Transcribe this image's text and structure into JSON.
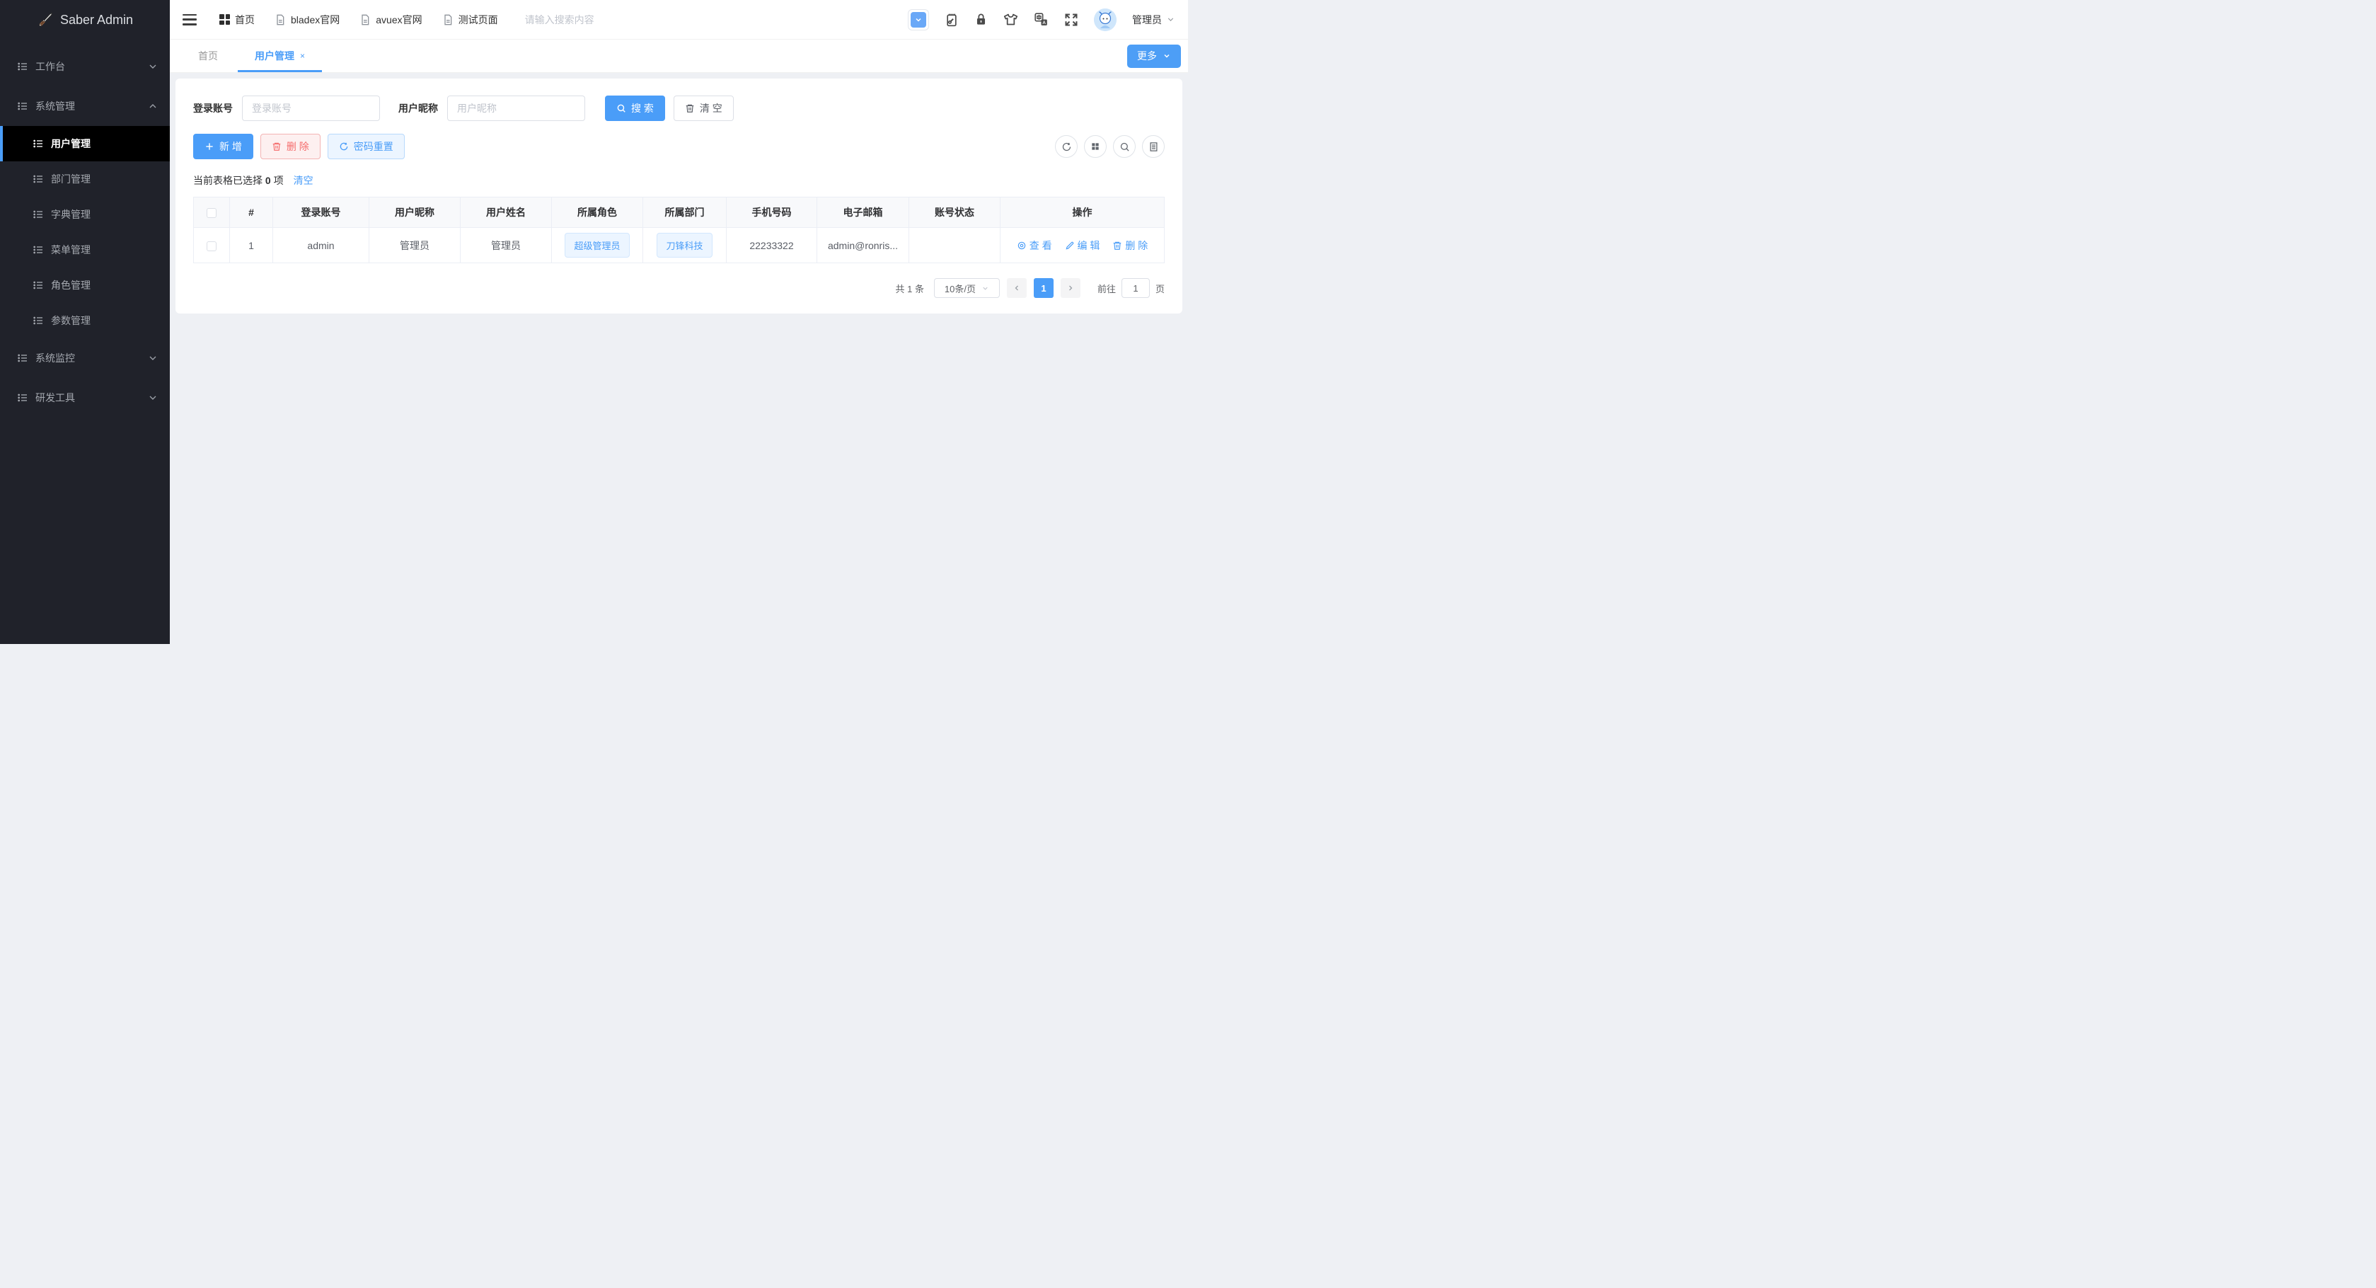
{
  "colors": {
    "accent": "#4a9df8",
    "link_blue": "#409eff",
    "danger_red": "#f56c6c",
    "sidebar_bg": "#20222a",
    "sidebar_active_bg": "#000000",
    "content_bg": "#eef0f4",
    "tag_bg": "#ecf5ff"
  },
  "logo": {
    "title": "Saber Admin"
  },
  "sidebar": {
    "items": [
      {
        "label": "工作台",
        "state": "collapsed"
      },
      {
        "label": "系统管理",
        "state": "expanded"
      },
      {
        "label": "系统监控",
        "state": "collapsed"
      },
      {
        "label": "研发工具",
        "state": "collapsed"
      }
    ],
    "system_children": [
      {
        "label": "用户管理",
        "active": true
      },
      {
        "label": "部门管理",
        "active": false
      },
      {
        "label": "字典管理",
        "active": false
      },
      {
        "label": "菜单管理",
        "active": false
      },
      {
        "label": "角色管理",
        "active": false
      },
      {
        "label": "参数管理",
        "active": false
      }
    ]
  },
  "topbar": {
    "nav": [
      {
        "label": "首页",
        "icon": "grid-icon"
      },
      {
        "label": "bladex官网",
        "icon": "document-icon"
      },
      {
        "label": "avuex官网",
        "icon": "document-icon"
      },
      {
        "label": "测试页面",
        "icon": "document-icon"
      }
    ],
    "search_placeholder": "请输入搜索内容",
    "user_name": "管理员"
  },
  "tabs": {
    "items": [
      {
        "label": "首页",
        "active": false
      },
      {
        "label": "用户管理",
        "active": true,
        "close": "×"
      }
    ],
    "more_label": "更多"
  },
  "filters": {
    "account_label": "登录账号",
    "account_placeholder": "登录账号",
    "account_value": "",
    "nickname_label": "用户昵称",
    "nickname_placeholder": "用户昵称",
    "nickname_value": "",
    "search_label": "搜 索",
    "clear_label": "清 空"
  },
  "toolbar": {
    "add_label": "新 增",
    "delete_label": "删 除",
    "reset_pwd_label": "密码重置"
  },
  "selection": {
    "text_before": "当前表格已选择",
    "count": "0",
    "text_after": "项",
    "clear_label": "清空"
  },
  "table": {
    "columns": [
      "#",
      "登录账号",
      "用户昵称",
      "用户姓名",
      "所属角色",
      "所属部门",
      "手机号码",
      "电子邮箱",
      "账号状态",
      "操作"
    ],
    "rows": [
      {
        "index": "1",
        "account": "admin",
        "nickname": "管理员",
        "name": "管理员",
        "role_tag": "超级管理员",
        "dept_tag": "刀锋科技",
        "phone": "22233322",
        "email": "admin@ronris...",
        "status": "",
        "actions": {
          "view": "查 看",
          "edit": "编 辑",
          "delete": "删 除"
        }
      }
    ]
  },
  "pagination": {
    "total_text": "共 1 条",
    "page_size": "10条/页",
    "current_page": "1",
    "goto_label": "前往",
    "goto_value": "1",
    "page_unit": "页"
  }
}
